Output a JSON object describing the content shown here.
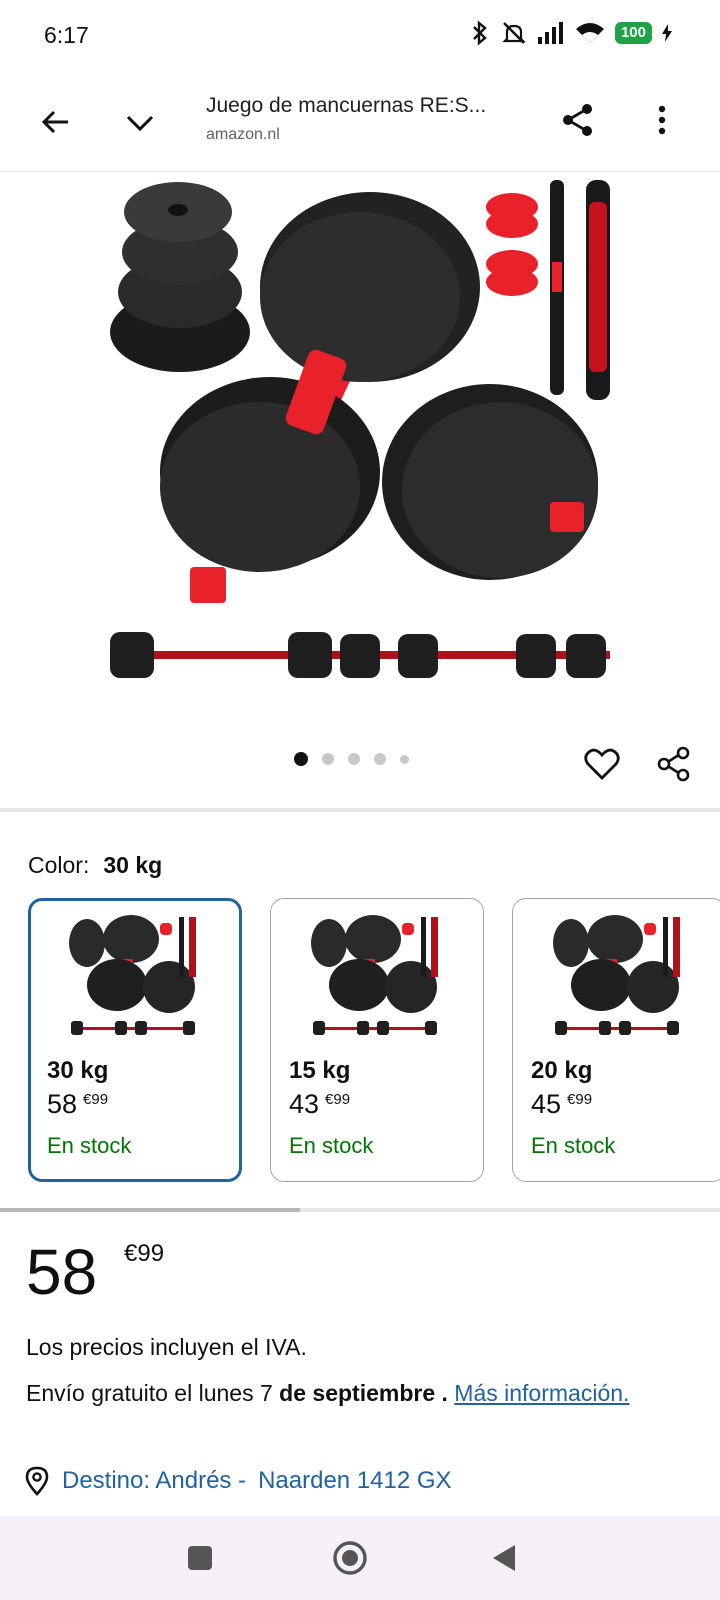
{
  "status_bar": {
    "time": "6:17",
    "battery": "100",
    "icons": [
      "bluetooth-icon",
      "mute-icon",
      "signal-icon",
      "wifi-icon",
      "battery-icon"
    ]
  },
  "top_bar": {
    "title": "Juego de mancuernas RE:S...",
    "domain": "amazon.nl",
    "icons": [
      "back-arrow-icon",
      "chevron-down-icon",
      "share-icon",
      "more-vert-icon"
    ]
  },
  "gallery": {
    "dots_count": 5,
    "active_dot": 1
  },
  "color_selector": {
    "label": "Color:",
    "selected_value": "30 kg"
  },
  "variants": [
    {
      "name": "30 kg",
      "price_whole": "58",
      "price_fraction": "€99",
      "stock": "En stock",
      "selected": true
    },
    {
      "name": "15 kg",
      "price_whole": "43",
      "price_fraction": "€99",
      "stock": "En stock",
      "selected": false
    },
    {
      "name": "20 kg",
      "price_whole": "45",
      "price_fraction": "€99",
      "stock": "En stock",
      "selected": false
    }
  ],
  "price": {
    "whole": "58",
    "fraction": "€99"
  },
  "vat_note": "Los precios incluyen el IVA.",
  "delivery": {
    "prefix": "Envío gratuito el lunes 7",
    "date_bold": "de septiembre .",
    "link": "Más información."
  },
  "destination": {
    "name": "Destino: Andrés -",
    "location": "Naarden 1412 GX"
  },
  "colors": {
    "link_blue": "#2162a1",
    "stock_green": "#007600",
    "battery_green": "#1ea446",
    "accent_red": "#e8212b"
  }
}
